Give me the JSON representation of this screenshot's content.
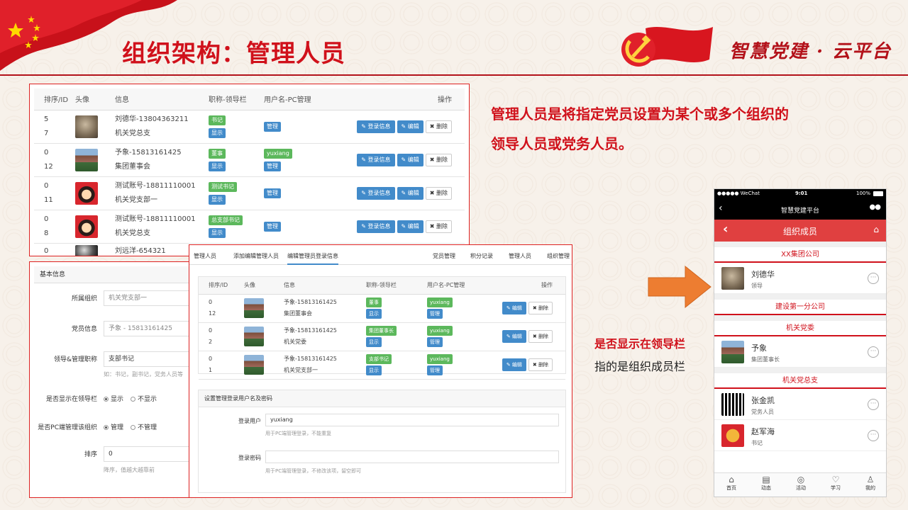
{
  "page": {
    "title": "组织架构：管理人员",
    "brand": "智慧党建 · 云平台"
  },
  "description": {
    "line1": "管理人员是将指定党员设置为某个或多个组织的",
    "line2": "领导人员或党务人员。"
  },
  "annotation": {
    "line1": "是否显示在领导栏",
    "line2": "指的是组织成员栏"
  },
  "colors": {
    "accent": "#d0111b",
    "green": "#5cb85c",
    "blue": "#428bca",
    "arrow": "#ed7d31"
  },
  "main_table": {
    "headers": [
      "排序/ID",
      "头像",
      "信息",
      "职称-领导栏",
      "用户名-PC管理",
      "操作"
    ],
    "rows": [
      {
        "sort": "5",
        "id": "7",
        "avatar": "coin",
        "name": "刘德华-13804363211",
        "org": "机关党总支",
        "title": "书记",
        "show": "显示",
        "user": "",
        "pc": "管理"
      },
      {
        "sort": "0",
        "id": "12",
        "avatar": "building",
        "name": "予象-15813161425",
        "org": "集团董事会",
        "title": "董事",
        "show": "显示",
        "user": "yuxiang",
        "pc": "管理"
      },
      {
        "sort": "0",
        "id": "11",
        "avatar": "girl",
        "name": "测试账号-18811110001",
        "org": "机关党支部一",
        "title": "测试书记",
        "show": "显示",
        "user": "",
        "pc": "管理"
      },
      {
        "sort": "0",
        "id": "8",
        "avatar": "girl",
        "name": "测试账号-18811110001",
        "org": "机关党总支",
        "title": "总支部书记",
        "show": "显示",
        "user": "",
        "pc": "管理"
      },
      {
        "sort": "0",
        "id": "",
        "avatar": "earth",
        "name": "刘远洋-654321",
        "org": "",
        "title": "",
        "show": "",
        "user": "",
        "pc": ""
      }
    ],
    "btn_login": "登录信息",
    "btn_edit": "编辑",
    "btn_delete": "删除"
  },
  "form": {
    "section": "基本信息",
    "org_label": "所属组织",
    "org_placeholder": "机关党支部一",
    "member_label": "党员信息",
    "member_placeholder": "予象 - 15813161425",
    "title_label": "领导&管理职称",
    "title_value": "支部书记",
    "title_help": "如：书记，副书记，党务人员等",
    "show_label": "是否显示在领导栏",
    "show_yes": "显示",
    "show_no": "不显示",
    "pc_label": "是否PC端管理该组织",
    "pc_yes": "管理",
    "pc_no": "不管理",
    "sort_label": "排序",
    "sort_value": "0",
    "sort_help": "降序，值越大越靠前"
  },
  "edit_panel": {
    "tabs": [
      "管理人员",
      "添加编辑管理人员",
      "编辑管理员登录信息"
    ],
    "right_tabs": [
      "党员管理",
      "积分记录",
      "管理人员",
      "组织管理"
    ],
    "headers": [
      "排序/ID",
      "头像",
      "信息",
      "职称-领导栏",
      "用户名-PC管理",
      "操作"
    ],
    "rows": [
      {
        "sort": "0",
        "id": "12",
        "name": "予象-15813161425",
        "org": "集团董事会",
        "title": "董事",
        "show": "显示",
        "user": "yuxiang",
        "pc": "管理"
      },
      {
        "sort": "0",
        "id": "2",
        "name": "予象-15813161425",
        "org": "机关党委",
        "title": "集团董事长",
        "show": "显示",
        "user": "yuxiang",
        "pc": "管理"
      },
      {
        "sort": "0",
        "id": "1",
        "name": "予象-15813161425",
        "org": "机关党支部一",
        "title": "支部书记",
        "show": "显示",
        "user": "yuxiang",
        "pc": "管理"
      }
    ],
    "btn_edit": "编辑",
    "btn_delete": "删除",
    "login_section": "设置管理登录用户名及密码",
    "login_user_label": "登录用户",
    "login_user_value": "yuxiang",
    "login_user_help": "用于PC端管理登录，不能重复",
    "login_pwd_label": "登录密码",
    "login_pwd_value": "",
    "login_pwd_help": "用于PC端管理登录，不修改该项，留空即可"
  },
  "phone": {
    "carrier": "●●●●● WeChat",
    "time": "9:01",
    "battery": "100%",
    "nav_title": "智慧党建平台",
    "header": "组织成员",
    "groups": [
      {
        "name": "XX集团公司",
        "members": [
          {
            "name": "刘德华",
            "role": "领导",
            "avatar": "coin"
          }
        ]
      },
      {
        "name": "建设第一分公司",
        "members": []
      },
      {
        "name": "机关党委",
        "members": [
          {
            "name": "予象",
            "role": "集团董事长",
            "avatar": "building"
          }
        ]
      },
      {
        "name": "机关党总支",
        "members": [
          {
            "name": "张金凯",
            "role": "党务人员",
            "avatar": "qr"
          },
          {
            "name": "赵军海",
            "role": "书记",
            "avatar": "fu"
          }
        ]
      }
    ],
    "tabs": [
      "首页",
      "动态",
      "活动",
      "学习",
      "我的"
    ]
  }
}
